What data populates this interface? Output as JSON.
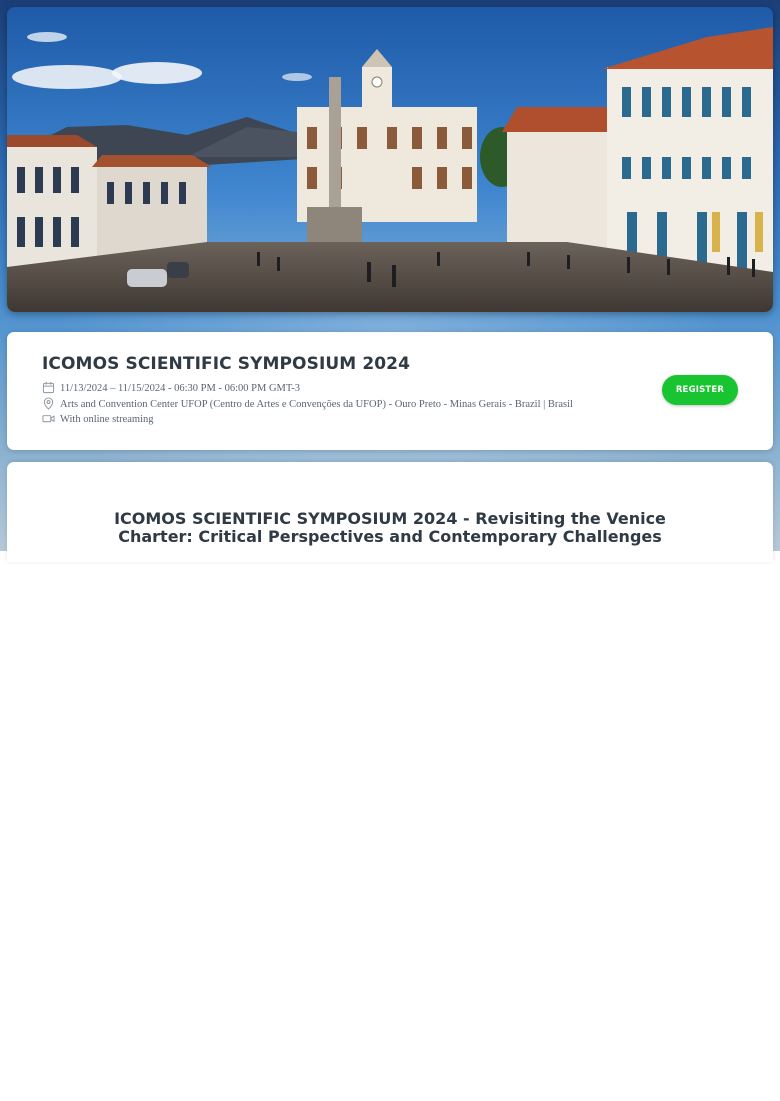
{
  "hero": {
    "image_icon": "town-square-photo"
  },
  "event": {
    "title": "ICOMOS SCIENTIFIC SYMPOSIUM 2024",
    "date": "11/13/2024 – 11/15/2024 - 06:30 PM - 06:00 PM GMT-3",
    "location": "Arts and Convention Center UFOP (Centro de Artes e Convenções da UFOP) - Ouro Preto - Minas Gerais - Brazil | Brasil",
    "streaming": "With online streaming",
    "register_label": "REGISTER"
  },
  "description": {
    "title": "ICOMOS SCIENTIFIC SYMPOSIUM 2024 - Revisiting the Venice Charter: Critical Perspectives and Contemporary Challenges"
  },
  "colors": {
    "accent": "#18c42f",
    "title_text": "#2f3a44",
    "meta_text": "#5a6570"
  },
  "icons": {
    "date": "calendar-icon",
    "location": "map-pin-icon",
    "streaming": "video-camera-icon"
  }
}
